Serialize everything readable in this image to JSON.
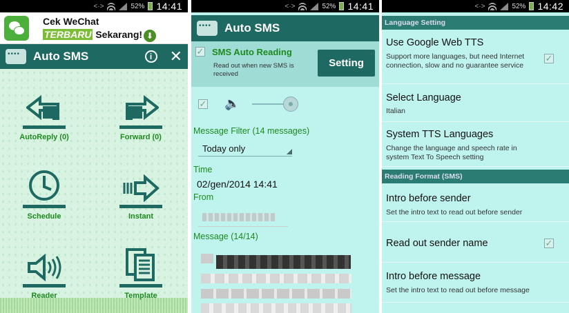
{
  "status_bars": [
    {
      "battery": "52%",
      "time": "14:41"
    },
    {
      "battery": "52%",
      "time": "14:41"
    },
    {
      "battery": "52%",
      "time": "14:42"
    }
  ],
  "ad": {
    "line1": "Cek WeChat",
    "tag": "TERBARU",
    "line2": "Sekarang!"
  },
  "app_title": "Auto SMS",
  "home_tiles": [
    {
      "label": "AutoReply (0)",
      "icon": "reply-arrow-icon"
    },
    {
      "label": "Forward (0)",
      "icon": "forward-arrow-icon"
    },
    {
      "label": "Schedule",
      "icon": "clock-icon"
    },
    {
      "label": "Instant",
      "icon": "instant-arrow-icon"
    },
    {
      "label": "Reader",
      "icon": "speaker-icon"
    },
    {
      "label": "Template",
      "icon": "documents-icon"
    }
  ],
  "reader": {
    "auto_reading_title": "SMS Auto Reading",
    "auto_reading_desc": "Read out when new SMS is received",
    "setting_button": "Setting",
    "filter_label": "Message Filter (14 messages)",
    "filter_value": "Today only",
    "time_label": "Time",
    "time_value": "02/gen/2014 14:41",
    "from_label": "From",
    "message_label": "Message (14/14)"
  },
  "settings": {
    "section1": "Language Setting",
    "items1": [
      {
        "title": "Use Google Web TTS",
        "summary": "Support more languages, but need Internet connection, slow and no guarantee service"
      },
      {
        "title": "Select Language",
        "summary": "Italian"
      },
      {
        "title": "System TTS Languages",
        "summary": "Change the language and speech rate in system Text To Speech setting"
      }
    ],
    "section2": "Reading Format (SMS)",
    "items2": [
      {
        "title": "Intro before sender",
        "summary": "Set the intro text to read out before sender"
      },
      {
        "title": "Read out sender name",
        "summary": ""
      },
      {
        "title": "Intro before message",
        "summary": "Set the intro text to read out before message"
      }
    ]
  }
}
